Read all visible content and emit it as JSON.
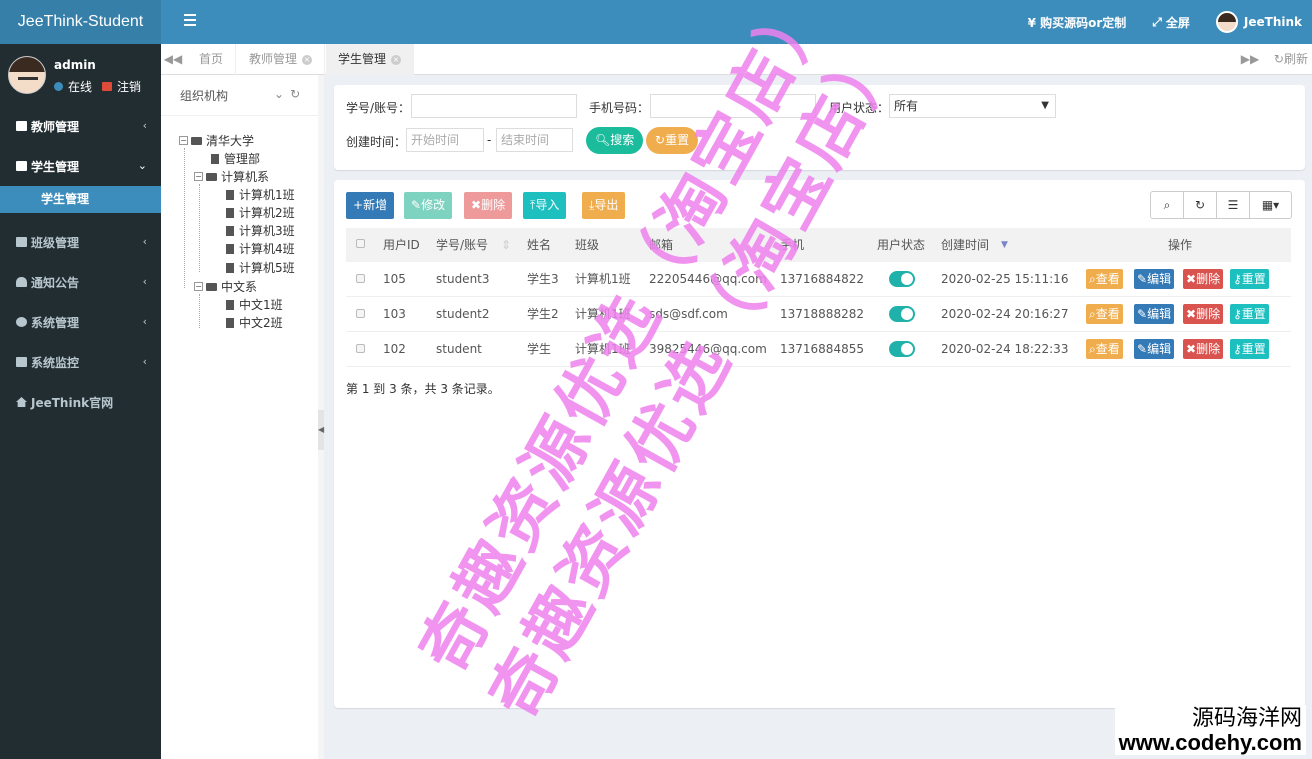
{
  "app": {
    "title": "JeeThink-Student"
  },
  "header": {
    "buy_label": "¥ 购买源码or定制",
    "fullscreen_label": "全屏",
    "user_label": "JeeThink"
  },
  "sidebar": {
    "username": "admin",
    "online_label": "在线",
    "logout_label": "注销",
    "items": [
      {
        "label": "教师管理"
      },
      {
        "label": "学生管理"
      },
      {
        "label": "学生管理"
      },
      {
        "label": "班级管理"
      },
      {
        "label": "通知公告"
      },
      {
        "label": "系统管理"
      },
      {
        "label": "系统监控"
      },
      {
        "label": "JeeThink官网"
      }
    ]
  },
  "tabs": [
    {
      "label": "首页"
    },
    {
      "label": "教师管理"
    },
    {
      "label": "学生管理"
    }
  ],
  "tab_refresh": "刷新",
  "tree": {
    "title": "组织机构",
    "nodes": [
      "清华大学",
      "管理部",
      "计算机系",
      "计算机1班",
      "计算机2班",
      "计算机3班",
      "计算机4班",
      "计算机5班",
      "中文系",
      "中文1班",
      "中文2班"
    ]
  },
  "search": {
    "account_label": "学号/账号：",
    "phone_label": "手机号码：",
    "status_label": "用户状态：",
    "status_value": "所有",
    "created_label": "创建时间：",
    "start_placeholder": "开始时间",
    "end_placeholder": "结束时间",
    "dash": "-",
    "search_btn": "搜索",
    "reset_btn": "重置"
  },
  "toolbar": {
    "add": "新增",
    "edit": "修改",
    "delete": "删除",
    "import": "导入",
    "export": "导出"
  },
  "table": {
    "headers": [
      "用户ID",
      "学号/账号",
      "姓名",
      "班级",
      "邮箱",
      "手机",
      "用户状态",
      "创建时间",
      "操作"
    ],
    "rows": [
      {
        "id": "105",
        "account": "student3",
        "name": "学生3",
        "class": "计算机1班",
        "email": "22205446@qq.com",
        "phone": "13716884822",
        "status": true,
        "created": "2020-02-25 15:11:16"
      },
      {
        "id": "103",
        "account": "student2",
        "name": "学生2",
        "class": "计算机1班",
        "email": "sds@sdf.com",
        "phone": "13718888282",
        "status": true,
        "created": "2020-02-24 20:16:27"
      },
      {
        "id": "102",
        "account": "student",
        "name": "学生",
        "class": "计算机1班",
        "email": "39825446@qq.com",
        "phone": "13716884855",
        "status": true,
        "created": "2020-02-24 18:22:33"
      }
    ],
    "actions": {
      "view": "查看",
      "edit": "编辑",
      "delete": "删除",
      "reset": "重置"
    },
    "pager": "第 1 到 3 条，共 3 条记录。"
  },
  "watermarks": {
    "line1": "奇趣资源优选（淘宝店）",
    "line2": "奇趣资源优选（淘宝店）",
    "site_name": "源码海洋网",
    "site_url": "www.codehy.com"
  },
  "colors": {
    "header": "#3c8dbc",
    "sidebar": "#222d32",
    "primary": "#337ab7",
    "info": "#5bc0de",
    "warning": "#f0ad4e",
    "danger": "#d9534f",
    "success": "#1abc9c",
    "switch": "#20b2aa"
  }
}
